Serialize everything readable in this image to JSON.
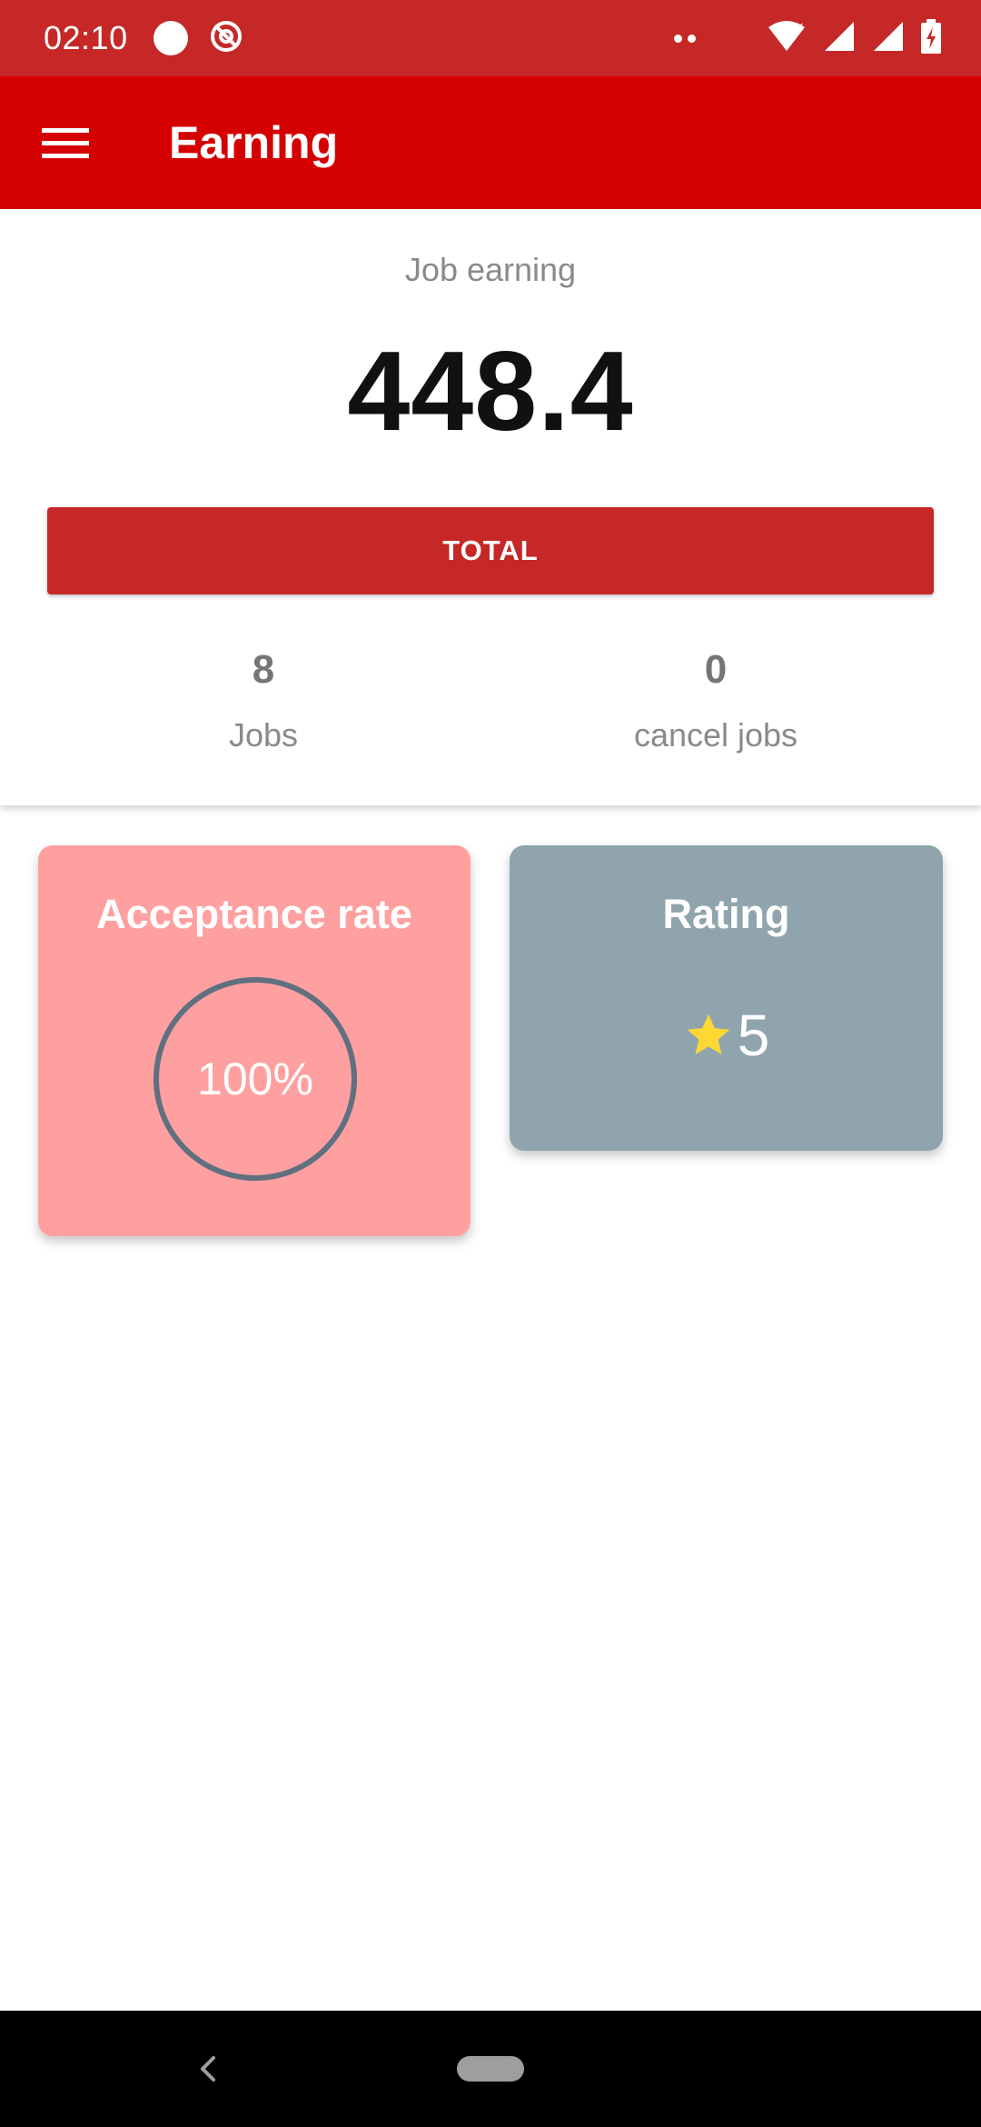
{
  "status_bar": {
    "time": "02:10",
    "icons": [
      "circle-notification-icon",
      "sync-disabled-icon",
      "more-dots-icon",
      "wifi-icon",
      "signal-icon",
      "signal-icon",
      "battery-charging-icon"
    ]
  },
  "app_bar": {
    "title": "Earning",
    "menu_icon": "hamburger-menu-icon"
  },
  "summary": {
    "earning_label": "Job earning",
    "earning_value": "448.4",
    "total_button": "TOTAL",
    "jobs": {
      "value": "8",
      "label": "Jobs"
    },
    "cancel_jobs": {
      "value": "0",
      "label": "cancel jobs"
    }
  },
  "tiles": {
    "acceptance": {
      "title": "Acceptance rate",
      "value_text": "100%",
      "fraction": 1.0
    },
    "rating": {
      "title": "Rating",
      "value": "5",
      "icon": "star-icon"
    }
  },
  "colors": {
    "status_bar": "#c62828",
    "app_bar": "#d50000",
    "total_button": "#c62828",
    "acceptance_tile": "#ffa0a0",
    "rating_tile": "#90a4ae",
    "star": "#fdd835",
    "ring": "#607080"
  },
  "nav_bar": {
    "icons": [
      "back-icon",
      "home-pill-icon"
    ]
  }
}
